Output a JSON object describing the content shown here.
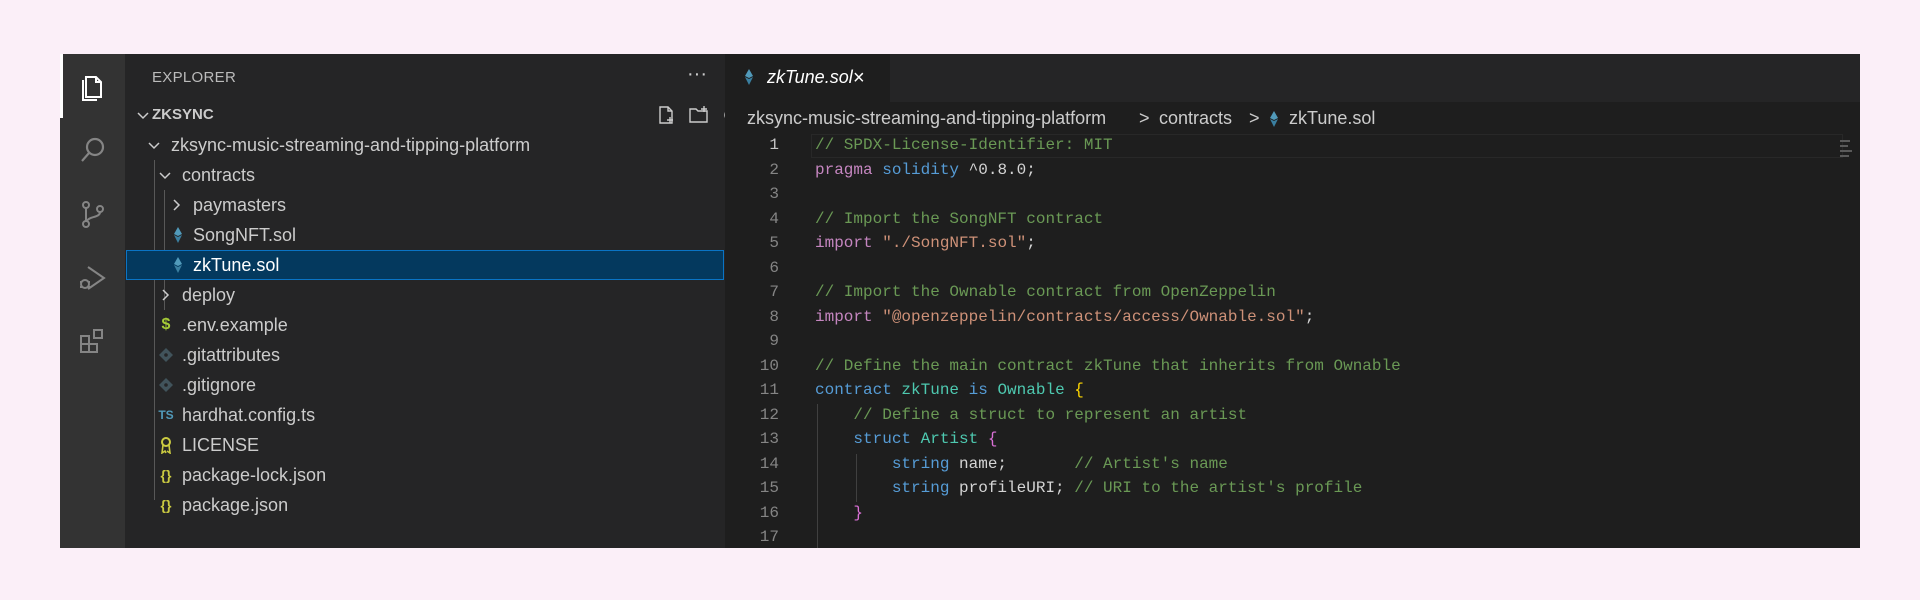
{
  "sidebar": {
    "title": "EXPLORER",
    "more_actions": "···",
    "section_title": "ZKSYNC",
    "tree": [
      {
        "label": "zksync-music-streaming-and-tipping-platform",
        "kind": "folder-open"
      },
      {
        "label": "contracts",
        "kind": "folder-open"
      },
      {
        "label": "paymasters",
        "kind": "folder-closed"
      },
      {
        "label": "SongNFT.sol",
        "kind": "solidity-file"
      },
      {
        "label": "zkTune.sol",
        "kind": "solidity-file",
        "selected": true
      },
      {
        "label": "deploy",
        "kind": "folder-closed"
      },
      {
        "label": ".env.example",
        "kind": "env-file",
        "icon_text": "$"
      },
      {
        "label": ".gitattributes",
        "kind": "git-file"
      },
      {
        "label": ".gitignore",
        "kind": "git-file"
      },
      {
        "label": "hardhat.config.ts",
        "kind": "ts-file",
        "icon_text": "TS"
      },
      {
        "label": "LICENSE",
        "kind": "license-file"
      },
      {
        "label": "package-lock.json",
        "kind": "json-file",
        "icon_text": "{}"
      },
      {
        "label": "package.json",
        "kind": "json-file",
        "icon_text": "{}"
      }
    ]
  },
  "editor": {
    "tab": {
      "label": "zkTune.sol",
      "close": "×"
    },
    "breadcrumb": {
      "root": "zksync-music-streaming-and-tipping-platform",
      "sep": ">",
      "folder": "contracts",
      "file": "zkTune.sol"
    },
    "lines": [
      {
        "n": "1",
        "segs": [
          {
            "t": "// SPDX-License-Identifier: MIT",
            "c": "c-comment"
          }
        ]
      },
      {
        "n": "2",
        "segs": [
          {
            "t": "pragma",
            "c": "c-kw"
          },
          {
            "t": " ",
            "c": "c-txt"
          },
          {
            "t": "solidity",
            "c": "c-type"
          },
          {
            "t": " ^0.8.0;",
            "c": "c-txt"
          }
        ]
      },
      {
        "n": "3",
        "segs": []
      },
      {
        "n": "4",
        "segs": [
          {
            "t": "// Import the SongNFT contract",
            "c": "c-comment"
          }
        ]
      },
      {
        "n": "5",
        "segs": [
          {
            "t": "import",
            "c": "c-kw"
          },
          {
            "t": " ",
            "c": "c-txt"
          },
          {
            "t": "\"./SongNFT.sol\"",
            "c": "c-str"
          },
          {
            "t": ";",
            "c": "c-txt"
          }
        ]
      },
      {
        "n": "6",
        "segs": []
      },
      {
        "n": "7",
        "segs": [
          {
            "t": "// Import the Ownable contract from OpenZeppelin",
            "c": "c-comment"
          }
        ]
      },
      {
        "n": "8",
        "segs": [
          {
            "t": "import",
            "c": "c-kw"
          },
          {
            "t": " ",
            "c": "c-txt"
          },
          {
            "t": "\"@openzeppelin/contracts/access/Ownable.sol\"",
            "c": "c-str"
          },
          {
            "t": ";",
            "c": "c-txt"
          }
        ]
      },
      {
        "n": "9",
        "segs": []
      },
      {
        "n": "10",
        "segs": [
          {
            "t": "// Define the main contract zkTune that inherits from Ownable",
            "c": "c-comment"
          }
        ]
      },
      {
        "n": "11",
        "segs": [
          {
            "t": "contract",
            "c": "c-type"
          },
          {
            "t": " ",
            "c": "c-txt"
          },
          {
            "t": "zkTune",
            "c": "c-cls"
          },
          {
            "t": " ",
            "c": "c-txt"
          },
          {
            "t": "is",
            "c": "c-type"
          },
          {
            "t": " ",
            "c": "c-txt"
          },
          {
            "t": "Ownable",
            "c": "c-cls"
          },
          {
            "t": " ",
            "c": "c-txt"
          },
          {
            "t": "{",
            "c": "c-br1"
          }
        ]
      },
      {
        "n": "12",
        "segs": [
          {
            "t": "    ",
            "c": "c-txt"
          },
          {
            "t": "// Define a struct to represent an artist",
            "c": "c-comment"
          }
        ]
      },
      {
        "n": "13",
        "segs": [
          {
            "t": "    ",
            "c": "c-txt"
          },
          {
            "t": "struct",
            "c": "c-type"
          },
          {
            "t": " ",
            "c": "c-txt"
          },
          {
            "t": "Artist",
            "c": "c-cls"
          },
          {
            "t": " ",
            "c": "c-txt"
          },
          {
            "t": "{",
            "c": "c-br2"
          }
        ]
      },
      {
        "n": "14",
        "segs": [
          {
            "t": "        ",
            "c": "c-txt"
          },
          {
            "t": "string",
            "c": "c-type"
          },
          {
            "t": " name;       ",
            "c": "c-txt"
          },
          {
            "t": "// Artist's name",
            "c": "c-comment"
          }
        ]
      },
      {
        "n": "15",
        "segs": [
          {
            "t": "        ",
            "c": "c-txt"
          },
          {
            "t": "string",
            "c": "c-type"
          },
          {
            "t": " profileURI; ",
            "c": "c-txt"
          },
          {
            "t": "// URI to the artist's profile",
            "c": "c-comment"
          }
        ]
      },
      {
        "n": "16",
        "segs": [
          {
            "t": "    ",
            "c": "c-txt"
          },
          {
            "t": "}",
            "c": "c-br2"
          }
        ]
      },
      {
        "n": "17",
        "segs": []
      }
    ]
  },
  "icons": {
    "activity": [
      "files-icon",
      "search-icon",
      "source-control-icon",
      "run-debug-icon",
      "extensions-icon"
    ],
    "section_actions": [
      "new-file-icon",
      "new-folder-icon",
      "refresh-icon",
      "collapse-all-icon"
    ]
  },
  "colors": {
    "solidity": "#519aba",
    "env": "#a6cc37",
    "json": "#cbcb41",
    "ts": "#519aba",
    "license": "#cbcb41",
    "git": "#41535b"
  }
}
